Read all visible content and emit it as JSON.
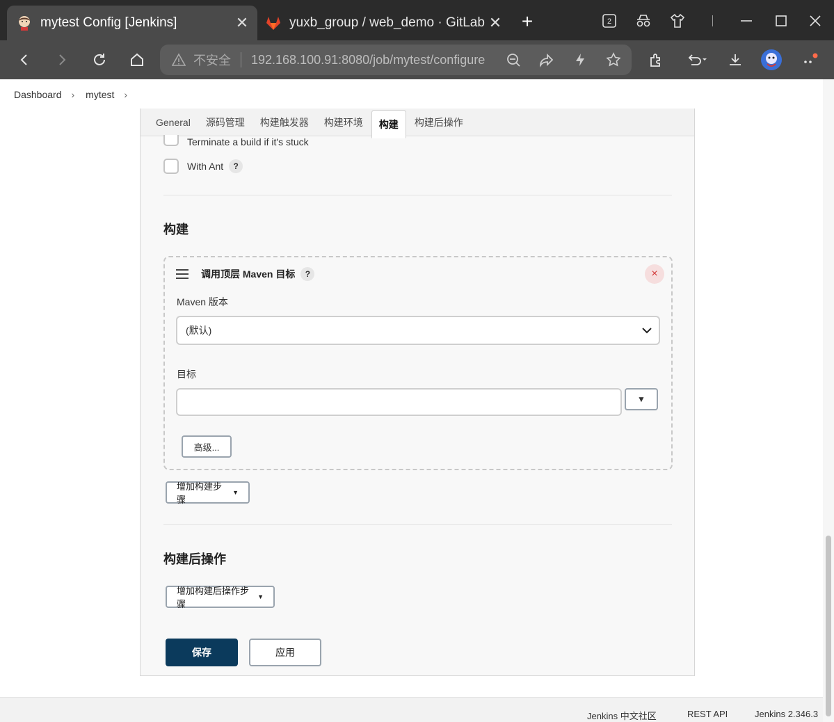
{
  "browser": {
    "tabs": [
      {
        "title": "mytest Config [Jenkins]",
        "active": true,
        "icon": "jenkins-icon"
      },
      {
        "title": "yuxb_group / web_demo · GitLab",
        "active": false,
        "icon": "gitlab-icon"
      }
    ],
    "tab_count_badge": "2",
    "address": {
      "security_label": "不安全",
      "url": "192.168.100.91:8080/job/mytest/configure"
    }
  },
  "breadcrumb": {
    "items": [
      "Dashboard",
      "mytest"
    ]
  },
  "config_tabs": [
    "General",
    "源码管理",
    "构建触发器",
    "构建环境",
    "构建",
    "构建后操作"
  ],
  "active_tab": "构建",
  "build_env": {
    "terminate_label": "Terminate a build if it's stuck",
    "ant_label": "With Ant",
    "help_symbol": "?"
  },
  "build": {
    "section_title": "构建",
    "step": {
      "title": "调用顶层 Maven 目标",
      "help_symbol": "?",
      "delete_symbol": "×",
      "maven_version_label": "Maven 版本",
      "maven_version_value": "(默认)",
      "goals_label": "目标",
      "goals_value": "",
      "advanced_label": "高级...",
      "expand_symbol": "▼"
    },
    "add_step_label": "增加构建步骤"
  },
  "post_build": {
    "section_title": "构建后操作",
    "add_step_label": "增加构建后操作步骤"
  },
  "actions": {
    "save_label": "保存",
    "apply_label": "应用"
  },
  "footer": {
    "community": "Jenkins 中文社区",
    "rest_api": "REST API",
    "version": "Jenkins 2.346.3"
  },
  "colors": {
    "save_button": "#0b3a5c",
    "delete_button_bg": "#f6dede",
    "delete_button_fg": "#d23a3a"
  }
}
